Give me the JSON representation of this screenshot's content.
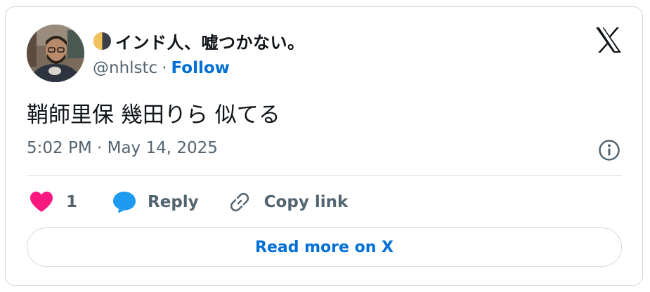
{
  "author": {
    "display_name": "インド人、嘘つかない。",
    "handle": "@nhlstc",
    "separator": "·",
    "follow_label": "Follow",
    "name_emoji_icon": "first-quarter-moon-icon",
    "avatar_icon": "profile-photo"
  },
  "tweet": {
    "text": "鞘師里保 幾田りら 似てる",
    "timestamp": "5:02 PM · May 14, 2025"
  },
  "actions": {
    "like_count": "1",
    "reply_label": "Reply",
    "copy_link_label": "Copy link"
  },
  "footer": {
    "read_more_label": "Read more on X"
  },
  "colors": {
    "link": "#006fd6",
    "secondary_text": "#536471",
    "border": "#cfd9de",
    "like": "#f91880",
    "reply": "#1d9bf0"
  }
}
